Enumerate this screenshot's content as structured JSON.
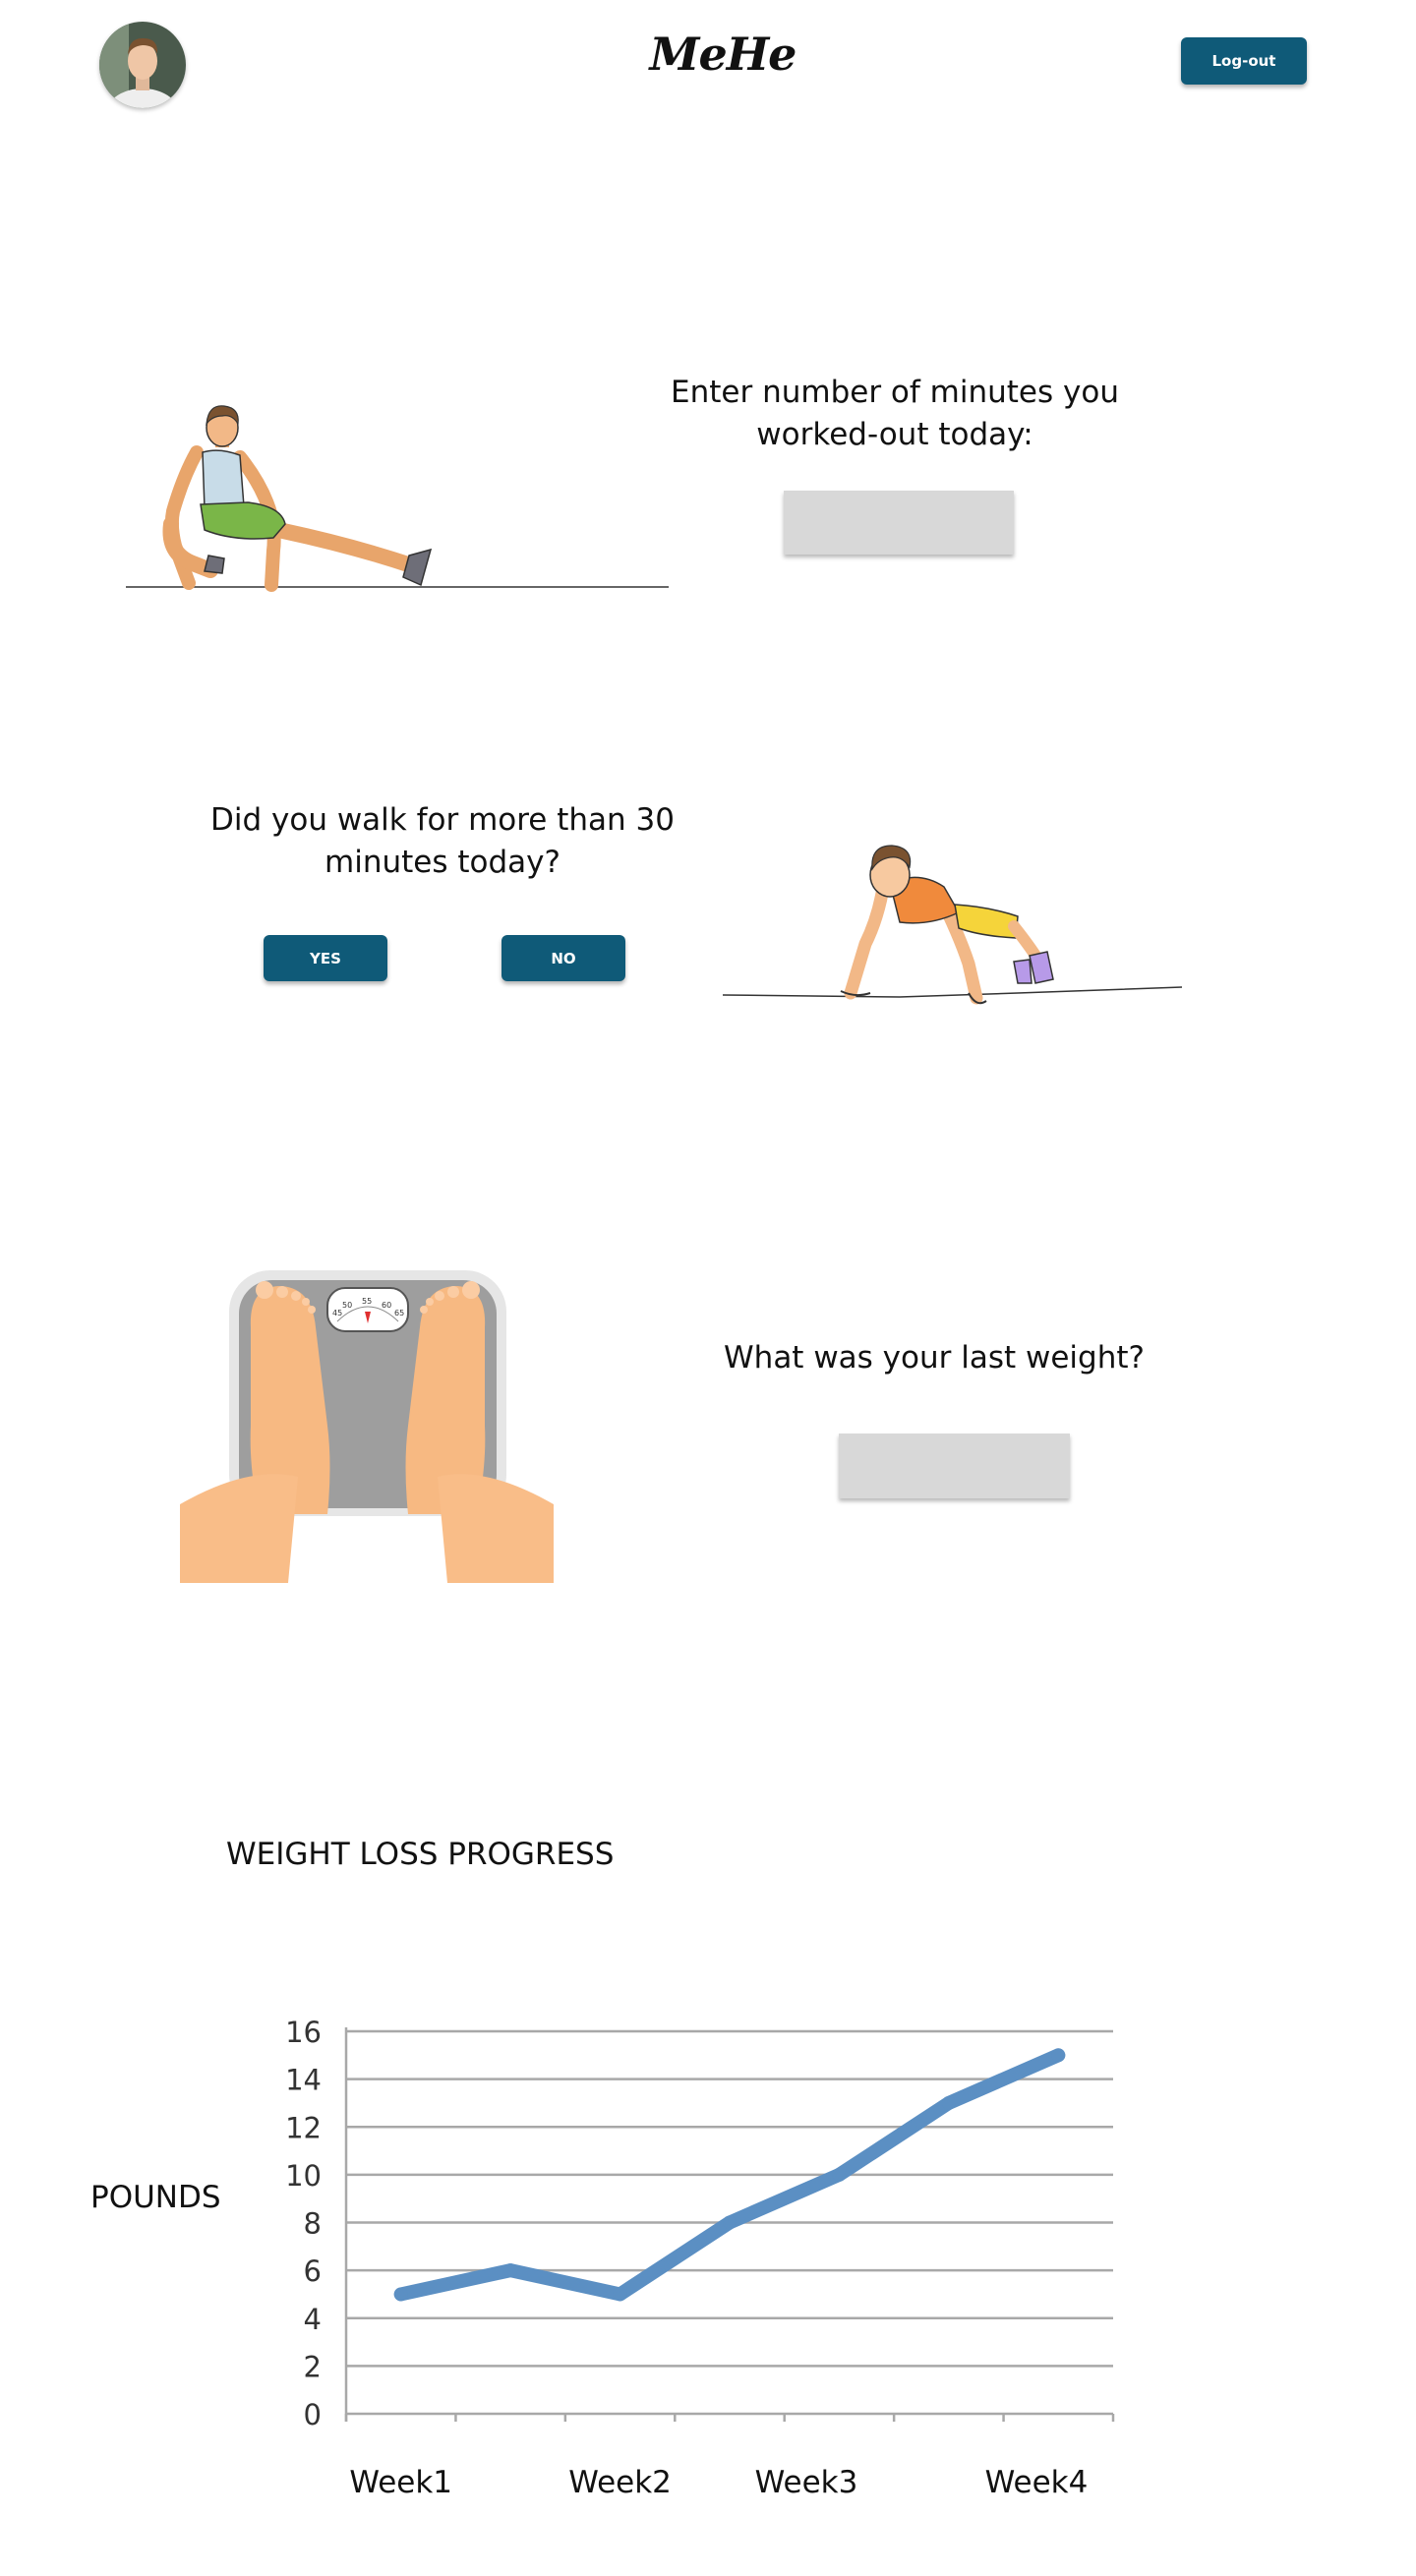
{
  "header": {
    "logo": "MeHe",
    "logout_label": "Log-out"
  },
  "workout": {
    "prompt_line1": "Enter number of minutes you",
    "prompt_line2": "worked-out today:",
    "input_value": "",
    "input_placeholder": ""
  },
  "walk": {
    "prompt_line1": "Did you walk for more than 30",
    "prompt_line2": "minutes today?",
    "yes_label": "YES",
    "no_label": "NO"
  },
  "weight": {
    "prompt": "What was your last weight?",
    "input_value": "",
    "input_placeholder": "",
    "scale_dial": [
      "45",
      "50",
      "55",
      "60",
      "65"
    ]
  },
  "progress": {
    "title": "WEIGHT LOSS PROGRESS",
    "ylabel": "POUNDS"
  },
  "colors": {
    "button": "#0f5a78",
    "field": "#d8d8d8",
    "line": "#5b8fc3"
  },
  "chart_data": {
    "type": "line",
    "categories": [
      "Week1",
      "",
      "Week2",
      "",
      "Week3",
      "",
      "Week4"
    ],
    "x": [
      1,
      2,
      3,
      4,
      5,
      6,
      7
    ],
    "series": [
      {
        "values": [
          5,
          6,
          5,
          8,
          10,
          13,
          15
        ]
      }
    ],
    "yticks": [
      0,
      2,
      4,
      6,
      8,
      10,
      12,
      14,
      16
    ],
    "ylim": [
      0,
      16
    ],
    "xlabels": [
      "Week1",
      "Week2",
      "Week3",
      "Week4"
    ],
    "title": "WEIGHT LOSS PROGRESS",
    "ylabel": "POUNDS",
    "grid": true
  }
}
